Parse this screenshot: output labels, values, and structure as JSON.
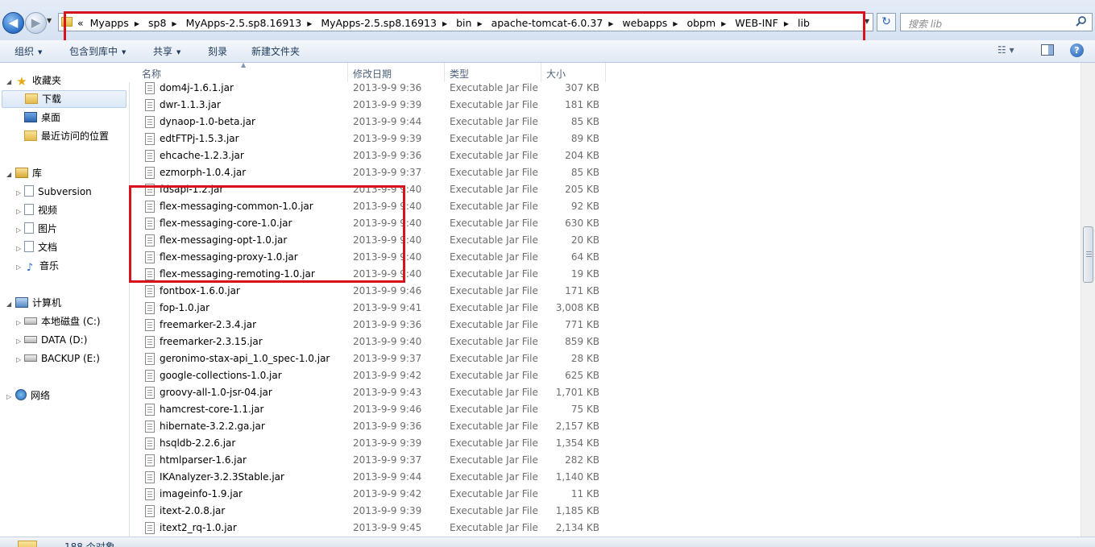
{
  "address": {
    "overflow_label": "«",
    "breadcrumbs": [
      "Myapps",
      "sp8",
      "MyApps-2.5.sp8.16913",
      "MyApps-2.5.sp8.16913",
      "bin",
      "apache-tomcat-6.0.37",
      "webapps",
      "obpm",
      "WEB-INF",
      "lib"
    ]
  },
  "search": {
    "placeholder": "搜索 lib"
  },
  "toolbar": {
    "organize": "组织",
    "include_in_library": "包含到库中",
    "share": "共享",
    "burn": "刻录",
    "new_folder": "新建文件夹"
  },
  "columns": {
    "name": "名称",
    "date": "修改日期",
    "type": "类型",
    "size": "大小"
  },
  "nav": {
    "favorites": "收藏夹",
    "downloads": "下载",
    "desktop": "桌面",
    "recent": "最近访问的位置",
    "libraries": "库",
    "subversion": "Subversion",
    "videos": "视频",
    "pictures": "图片",
    "documents": "文档",
    "music": "音乐",
    "computer": "计算机",
    "drive_c": "本地磁盘 (C:)",
    "drive_d": "DATA (D:)",
    "drive_e": "BACKUP (E:)",
    "network": "网络"
  },
  "files": [
    {
      "name": "dom4j-1.6.1.jar",
      "date": "2013-9-9 9:36",
      "type": "Executable Jar File",
      "size": "307 KB"
    },
    {
      "name": "dwr-1.1.3.jar",
      "date": "2013-9-9 9:39",
      "type": "Executable Jar File",
      "size": "181 KB"
    },
    {
      "name": "dynaop-1.0-beta.jar",
      "date": "2013-9-9 9:44",
      "type": "Executable Jar File",
      "size": "85 KB"
    },
    {
      "name": "edtFTPj-1.5.3.jar",
      "date": "2013-9-9 9:39",
      "type": "Executable Jar File",
      "size": "89 KB"
    },
    {
      "name": "ehcache-1.2.3.jar",
      "date": "2013-9-9 9:36",
      "type": "Executable Jar File",
      "size": "204 KB"
    },
    {
      "name": "ezmorph-1.0.4.jar",
      "date": "2013-9-9 9:37",
      "type": "Executable Jar File",
      "size": "85 KB"
    },
    {
      "name": "fdsapi-1.2.jar",
      "date": "2013-9-9 9:40",
      "type": "Executable Jar File",
      "size": "205 KB"
    },
    {
      "name": "flex-messaging-common-1.0.jar",
      "date": "2013-9-9 9:40",
      "type": "Executable Jar File",
      "size": "92 KB"
    },
    {
      "name": "flex-messaging-core-1.0.jar",
      "date": "2013-9-9 9:40",
      "type": "Executable Jar File",
      "size": "630 KB"
    },
    {
      "name": "flex-messaging-opt-1.0.jar",
      "date": "2013-9-9 9:40",
      "type": "Executable Jar File",
      "size": "20 KB"
    },
    {
      "name": "flex-messaging-proxy-1.0.jar",
      "date": "2013-9-9 9:40",
      "type": "Executable Jar File",
      "size": "64 KB"
    },
    {
      "name": "flex-messaging-remoting-1.0.jar",
      "date": "2013-9-9 9:40",
      "type": "Executable Jar File",
      "size": "19 KB"
    },
    {
      "name": "fontbox-1.6.0.jar",
      "date": "2013-9-9 9:46",
      "type": "Executable Jar File",
      "size": "171 KB"
    },
    {
      "name": "fop-1.0.jar",
      "date": "2013-9-9 9:41",
      "type": "Executable Jar File",
      "size": "3,008 KB"
    },
    {
      "name": "freemarker-2.3.4.jar",
      "date": "2013-9-9 9:36",
      "type": "Executable Jar File",
      "size": "771 KB"
    },
    {
      "name": "freemarker-2.3.15.jar",
      "date": "2013-9-9 9:40",
      "type": "Executable Jar File",
      "size": "859 KB"
    },
    {
      "name": "geronimo-stax-api_1.0_spec-1.0.jar",
      "date": "2013-9-9 9:37",
      "type": "Executable Jar File",
      "size": "28 KB"
    },
    {
      "name": "google-collections-1.0.jar",
      "date": "2013-9-9 9:42",
      "type": "Executable Jar File",
      "size": "625 KB"
    },
    {
      "name": "groovy-all-1.0-jsr-04.jar",
      "date": "2013-9-9 9:43",
      "type": "Executable Jar File",
      "size": "1,701 KB"
    },
    {
      "name": "hamcrest-core-1.1.jar",
      "date": "2013-9-9 9:46",
      "type": "Executable Jar File",
      "size": "75 KB"
    },
    {
      "name": "hibernate-3.2.2.ga.jar",
      "date": "2013-9-9 9:36",
      "type": "Executable Jar File",
      "size": "2,157 KB"
    },
    {
      "name": "hsqldb-2.2.6.jar",
      "date": "2013-9-9 9:39",
      "type": "Executable Jar File",
      "size": "1,354 KB"
    },
    {
      "name": "htmlparser-1.6.jar",
      "date": "2013-9-9 9:37",
      "type": "Executable Jar File",
      "size": "282 KB"
    },
    {
      "name": "IKAnalyzer-3.2.3Stable.jar",
      "date": "2013-9-9 9:44",
      "type": "Executable Jar File",
      "size": "1,140 KB"
    },
    {
      "name": "imageinfo-1.9.jar",
      "date": "2013-9-9 9:42",
      "type": "Executable Jar File",
      "size": "11 KB"
    },
    {
      "name": "itext-2.0.8.jar",
      "date": "2013-9-9 9:39",
      "type": "Executable Jar File",
      "size": "1,185 KB"
    },
    {
      "name": "itext2_rq-1.0.jar",
      "date": "2013-9-9 9:45",
      "type": "Executable Jar File",
      "size": "2,134 KB"
    }
  ],
  "status": {
    "item_count": "188 个对象"
  },
  "highlight_color": "#d8131b",
  "icons": [
    "back-arrow-icon",
    "forward-arrow-icon",
    "folder-icon",
    "refresh-icon",
    "search-icon",
    "view-options-icon",
    "preview-pane-icon",
    "help-icon",
    "jar-file-icon"
  ]
}
